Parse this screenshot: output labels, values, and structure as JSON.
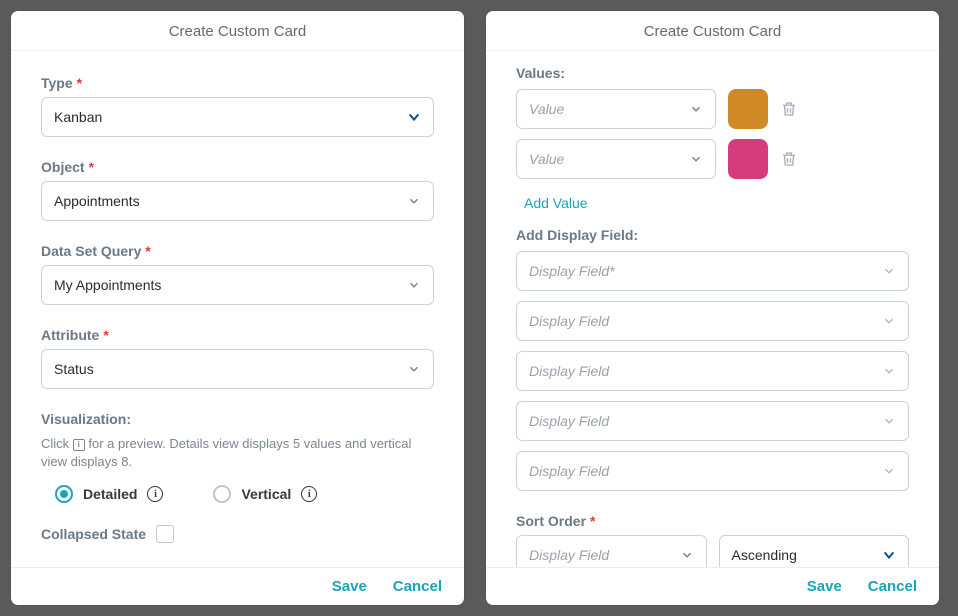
{
  "dialog_title": "Create Custom Card",
  "left": {
    "type": {
      "label": "Type",
      "value": "Kanban"
    },
    "object": {
      "label": "Object",
      "value": "Appointments"
    },
    "data_set_query": {
      "label": "Data Set Query",
      "value": "My Appointments"
    },
    "attribute": {
      "label": "Attribute",
      "value": "Status"
    },
    "visualization": {
      "label": "Visualization:",
      "helper_pre": "Click ",
      "helper_post": " for a preview. Details view displays 5 values and vertical view displays 8.",
      "options": {
        "detailed": "Detailed",
        "vertical": "Vertical"
      }
    },
    "collapsed_state": {
      "label": "Collapsed State"
    }
  },
  "right": {
    "values": {
      "label": "Values:",
      "placeholder": "Value",
      "colors": {
        "0": "#cf8a25",
        "1": "#d63c7c"
      },
      "add_label": "Add Value"
    },
    "add_display_field": {
      "label": "Add Display Field:",
      "placeholders": {
        "0": "Display Field*",
        "1": "Display Field",
        "2": "Display Field",
        "3": "Display Field",
        "4": "Display Field"
      }
    },
    "sort_order": {
      "label": "Sort Order",
      "field_placeholder": "Display Field",
      "direction": "Ascending"
    }
  },
  "footer": {
    "save": "Save",
    "cancel": "Cancel"
  }
}
